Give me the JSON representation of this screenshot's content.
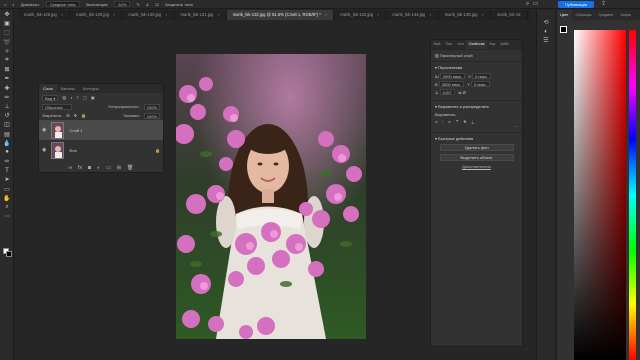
{
  "options_bar": {
    "mode_label": "Диапазон:",
    "mode_value": "Средние тона",
    "exposure_label": "Экспозиция:",
    "exposure_value": "64%",
    "protect_label": "Защитить тона",
    "publish_label": "Публикация"
  },
  "tabs": [
    {
      "label": "marik_lsk-128.jpg"
    },
    {
      "label": "marik_lsk-129.jpg"
    },
    {
      "label": "marik_lsk-130.jpg"
    },
    {
      "label": "marik_lsk-131.jpg"
    },
    {
      "label": "marik_lsk-132.jpg @ 51,5% (Слой 1, RGB/8*) *",
      "active": true
    },
    {
      "label": "marik_lsk-133.jpg"
    },
    {
      "label": "marik_lsk-134.jpg"
    },
    {
      "label": "marik_lsk-135.jpg"
    },
    {
      "label": "marik_lsk-13"
    }
  ],
  "layers_panel": {
    "tabs": [
      "Слои",
      "Каналы",
      "Контуры"
    ],
    "kind_label": "Вид",
    "blend_mode": "Обычные",
    "opacity_label": "Непрозрачность:",
    "opacity_value": "100%",
    "lock_label": "Закрепить:",
    "fill_label": "Заливка:",
    "fill_value": "100%",
    "layers": [
      {
        "name": "Слой 1",
        "selected": true
      },
      {
        "name": "Фон",
        "selected": false
      }
    ]
  },
  "properties_panel": {
    "tabs": [
      "Мой",
      "Опе",
      "Хол",
      "Свойства",
      "Кор",
      "Библ"
    ],
    "layer_type": "Пиксельный слой",
    "transform_title": "Перспектива",
    "w_value": "2000 пикс.",
    "h_value": "3000 пикс.",
    "x_value": "0 пикс.",
    "y_value": "0 пикс.",
    "angle_value": "0,00°",
    "align_title": "Выровнять и распределить",
    "align_label": "Выровнять:",
    "quick_title": "Быстрые действия",
    "btn_remove_bg": "Удалить фон",
    "btn_select_subject": "Выделить объект",
    "more_link": "Дополнительно"
  },
  "color_panel": {
    "tabs": [
      "Цвет",
      "Образцы",
      "Градиен",
      "Узоры"
    ]
  },
  "colors": {
    "accent": "#1473e6"
  }
}
